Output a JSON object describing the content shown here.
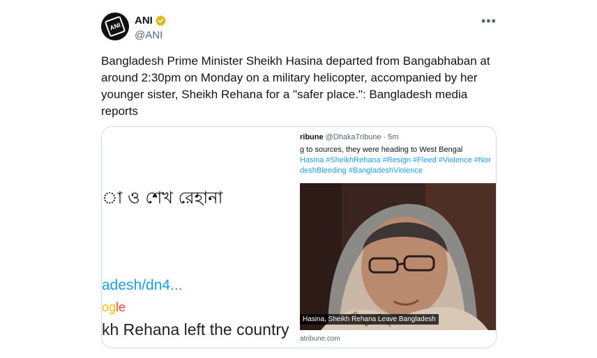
{
  "tweet": {
    "author_name": "ANI",
    "author_handle": "@ANI",
    "avatar_text": "ANI",
    "more_label": "•••",
    "text": "Bangladesh Prime Minister Sheikh Hasina departed from Bangabhaban at around 2:30pm on Monday on a military helicopter, accompanied by her younger sister, Sheikh Rehana for a \"safer place.\": Bangladesh media reports"
  },
  "card_left": {
    "bengali_text": "া ও শেখ রেহানা",
    "link_fragment": "adesh/dn4...",
    "google_fragment_1": "og",
    "google_fragment_2": "le",
    "rehana_fragment": "kh Rehana left the country"
  },
  "card_right": {
    "source_name": "ribune",
    "source_handle_time": " @DhakaTribune · 5m",
    "line1": "g to sources, they were heading to West Bengal",
    "line2": "Hasina #SheikhRehana #Resign #Fleed #Violence #Nor",
    "line3": "deshBleeding #BangladeshViolence",
    "photo_caption": "Hasina, Sheikh Rehana Leave Bangladesh",
    "domain": "atribune.com"
  },
  "colors": {
    "link": "#1d9bf0",
    "muted": "#536471",
    "verified_gold": "#e2b719"
  }
}
